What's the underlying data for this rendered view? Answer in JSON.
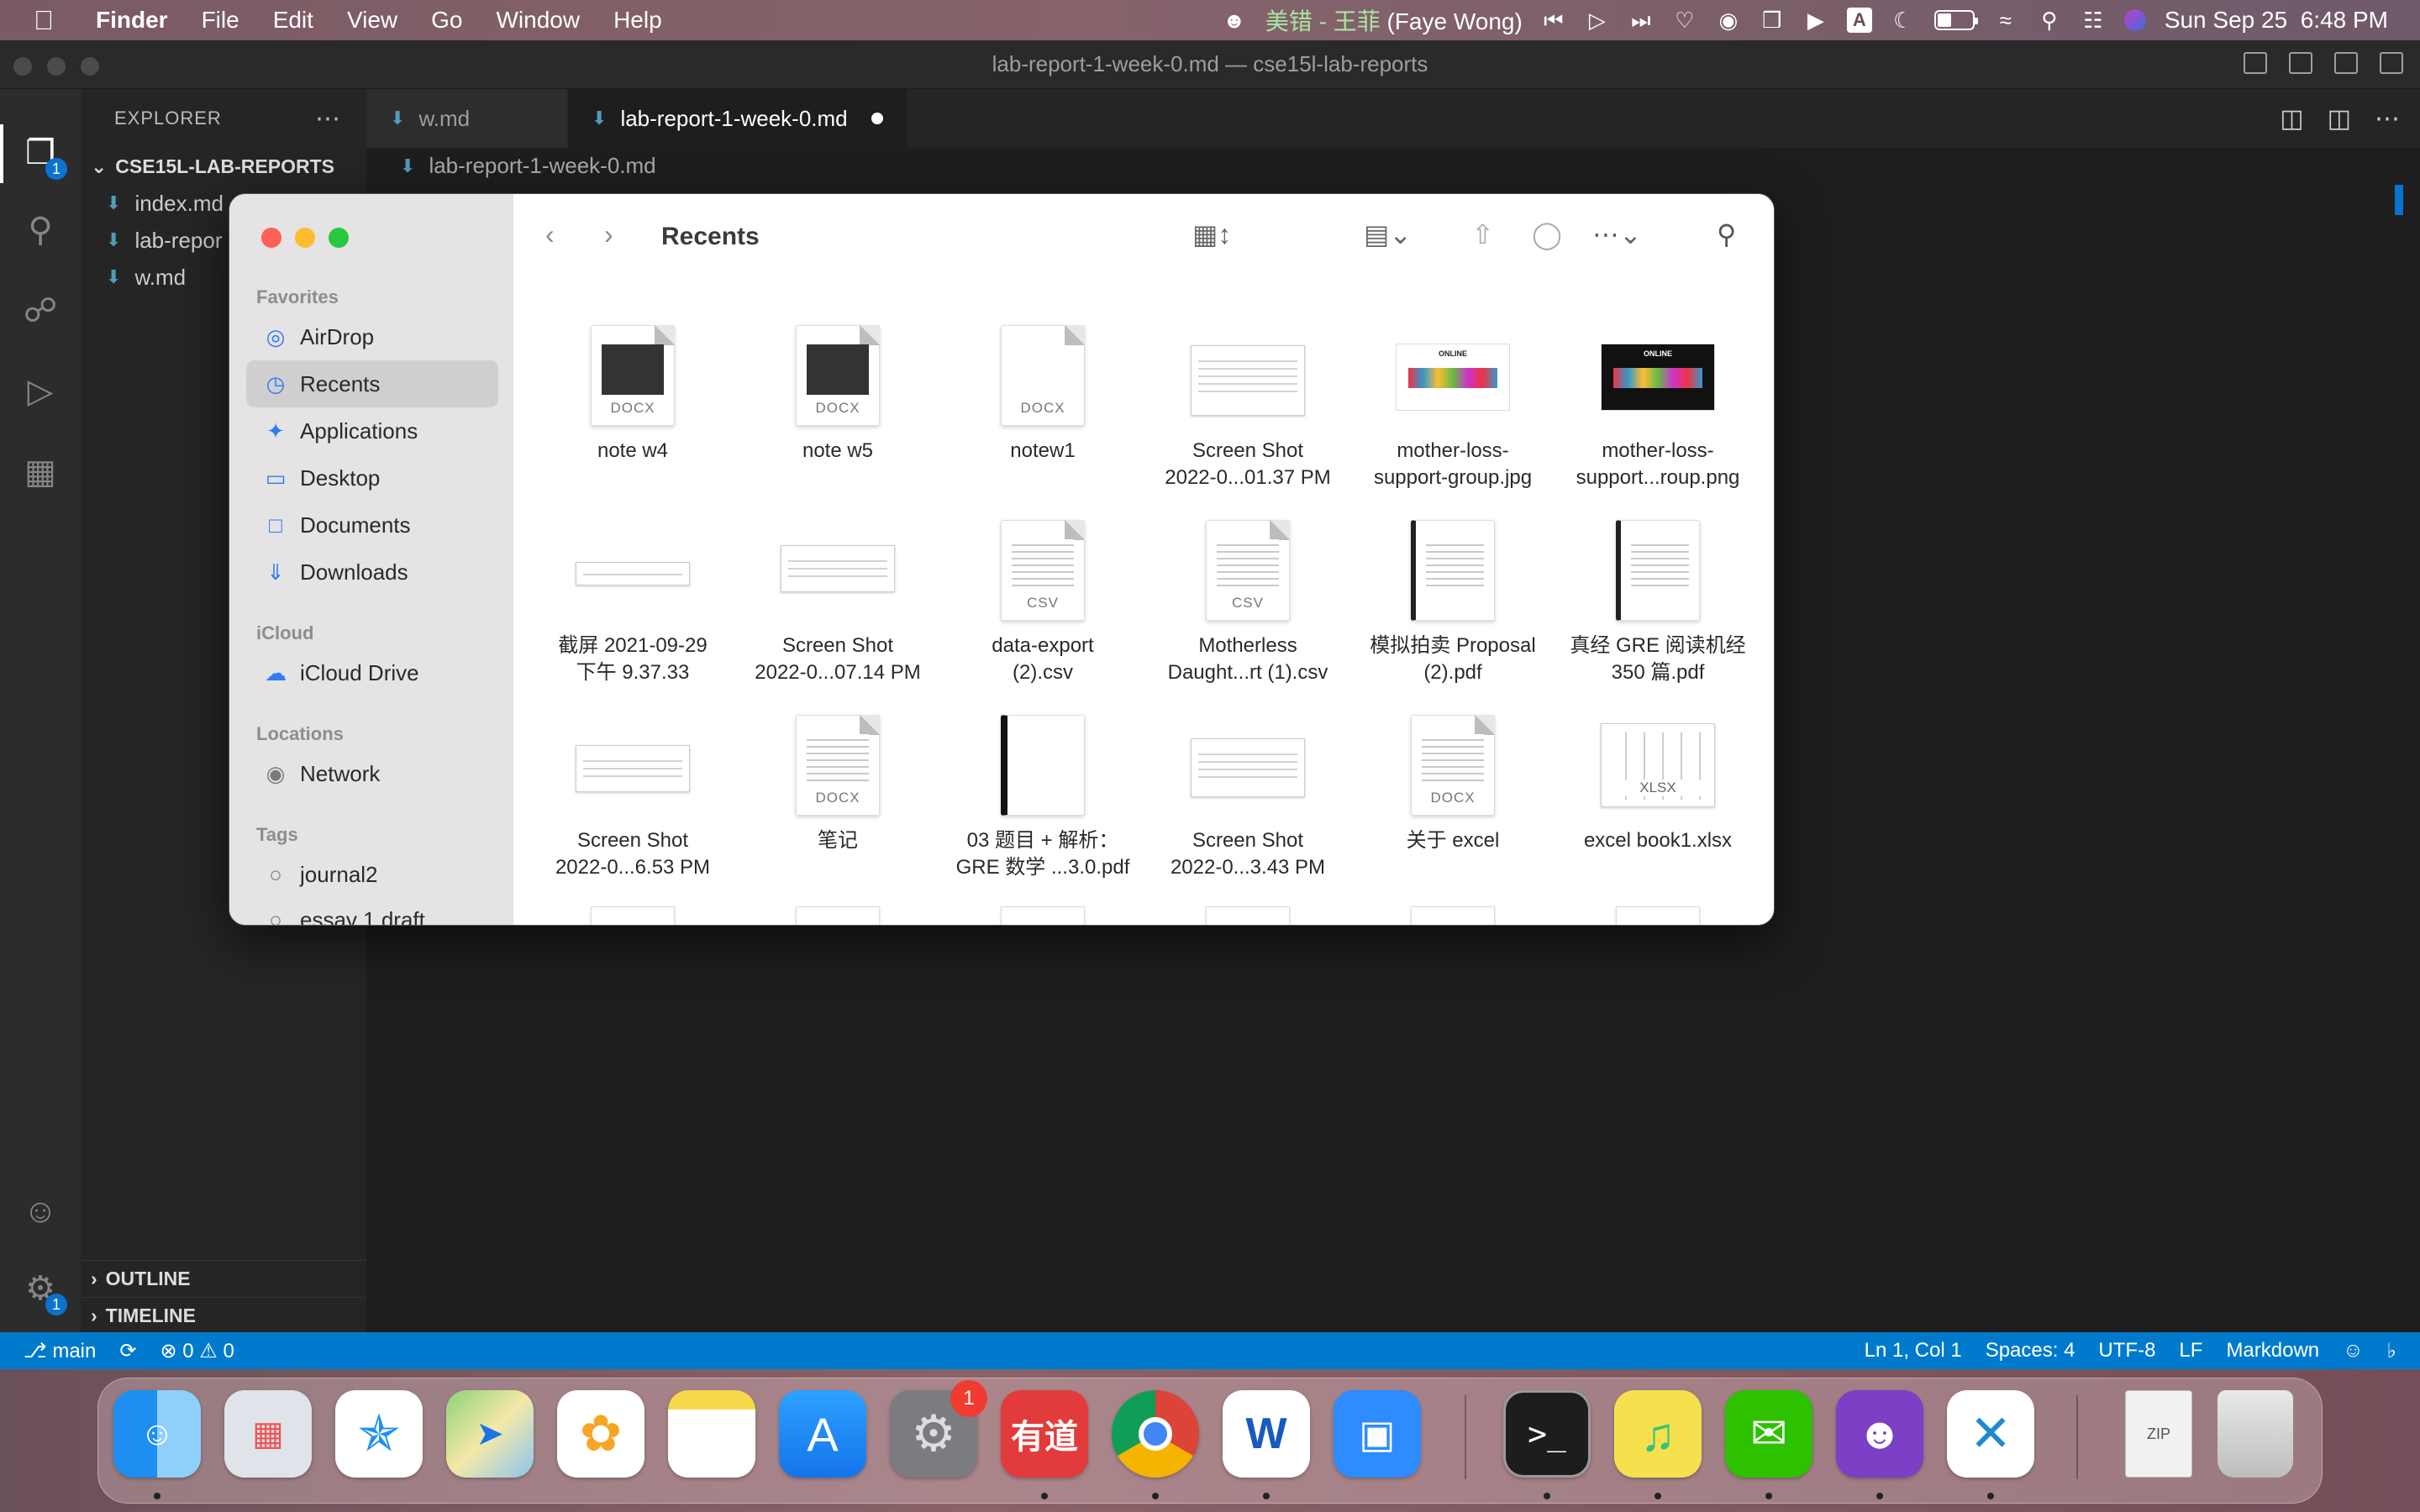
{
  "menubar": {
    "app": "Finder",
    "menus": [
      "File",
      "Edit",
      "View",
      "Go",
      "Window",
      "Help"
    ],
    "now_playing_cn": "美错 - 王菲",
    "now_playing_en": "(Faye Wong)",
    "datetime": "Sun Sep 25  6:48 PM",
    "input_source": "A",
    "battery_level": 0.4
  },
  "vscode": {
    "title": "lab-report-1-week-0.md — cse15l-lab-reports",
    "explorer_label": "EXPLORER",
    "folder": "CSE15L-LAB-REPORTS",
    "files": [
      "index.md",
      "lab-repor",
      "w.md"
    ],
    "outline": "OUTLINE",
    "timeline": "TIMELINE",
    "tabs": [
      {
        "label": "w.md"
      },
      {
        "label": "lab-report-1-week-0.md"
      }
    ],
    "breadcrumb": "lab-report-1-week-0.md",
    "explorer_badge": "1",
    "settings_badge": "1",
    "status": {
      "branch": "main",
      "errors": "0",
      "warnings": "0",
      "position": "Ln 1, Col 1",
      "spaces": "Spaces: 4",
      "encoding": "UTF-8",
      "eol": "LF",
      "language": "Markdown"
    }
  },
  "finder": {
    "title": "Recents",
    "sidebar": {
      "favorites_label": "Favorites",
      "favorites": [
        "AirDrop",
        "Recents",
        "Applications",
        "Desktop",
        "Documents",
        "Downloads"
      ],
      "icloud_label": "iCloud",
      "icloud": [
        "iCloud Drive"
      ],
      "locations_label": "Locations",
      "locations": [
        "Network"
      ],
      "tags_label": "Tags",
      "tags": [
        "journal2",
        "essay 1 draft"
      ]
    },
    "files": [
      {
        "name": "note w4",
        "kind": "DOCX"
      },
      {
        "name": "note w5",
        "kind": "DOCX"
      },
      {
        "name": "notew1",
        "kind": "DOCX"
      },
      {
        "name": "Screen Shot\n2022-0...01.37 PM",
        "kind": ""
      },
      {
        "name": "mother-loss-\nsupport-group.jpg",
        "kind": "ONLINE"
      },
      {
        "name": "mother-loss-\nsupport...roup.png",
        "kind": "ONLINE"
      },
      {
        "name": "截屏 2021-09-29\n下午 9.37.33",
        "kind": ""
      },
      {
        "name": "Screen Shot\n2022-0...07.14 PM",
        "kind": ""
      },
      {
        "name": "data-export\n(2).csv",
        "kind": "CSV"
      },
      {
        "name": "Motherless\nDaught...rt (1).csv",
        "kind": "CSV"
      },
      {
        "name": "模拟拍卖 Proposal\n(2).pdf",
        "kind": ""
      },
      {
        "name": "真经 GRE 阅读机经\n350 篇.pdf",
        "kind": ""
      },
      {
        "name": "Screen Shot\n2022-0...6.53 PM",
        "kind": ""
      },
      {
        "name": "笔记",
        "kind": "DOCX"
      },
      {
        "name": "03 题目 + 解析：\nGRE 数学 ...3.0.pdf",
        "kind": ""
      },
      {
        "name": "Screen Shot\n2022-0...3.43 PM",
        "kind": ""
      },
      {
        "name": "关于 excel",
        "kind": "DOCX"
      },
      {
        "name": "excel book1.xlsx",
        "kind": "XLSX"
      }
    ]
  },
  "dock": {
    "apps": [
      "Finder",
      "Launchpad",
      "Safari",
      "Maps",
      "Photos",
      "Notes",
      "App Store",
      "System Preferences",
      "有道",
      "Chrome",
      "Word",
      "Zoom",
      "Terminal",
      "QQ Music",
      "WeChat",
      "GitHub Desktop",
      "Visual Studio Code",
      "Archive",
      "Trash"
    ],
    "system_prefs_badge": "1",
    "youdao_label": "有道",
    "terminal_label": ">_",
    "word_label": "W",
    "zip_label": "ZIP"
  }
}
